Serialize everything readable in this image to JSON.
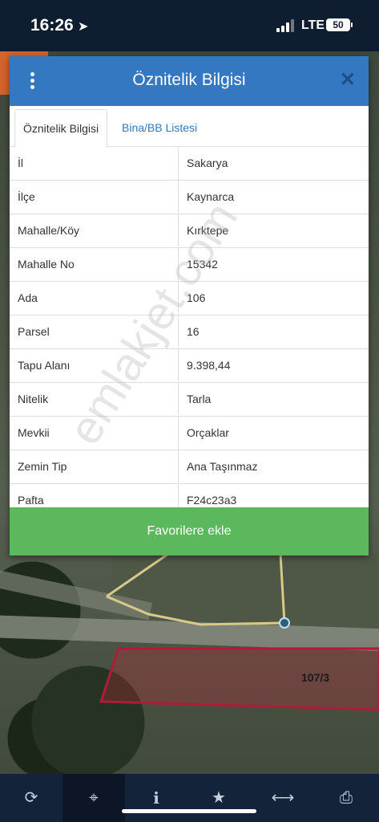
{
  "status_bar": {
    "time": "16:26",
    "network": "LTE",
    "battery": "50"
  },
  "dialog": {
    "title": "Öznitelik Bilgisi",
    "tabs": [
      "Öznitelik Bilgisi",
      "Bina/BB Listesi"
    ],
    "rows": [
      {
        "key": "İl",
        "value": "Sakarya"
      },
      {
        "key": "İlçe",
        "value": "Kaynarca"
      },
      {
        "key": "Mahalle/Köy",
        "value": "Kırktepe"
      },
      {
        "key": "Mahalle No",
        "value": "15342"
      },
      {
        "key": "Ada",
        "value": "106"
      },
      {
        "key": "Parsel",
        "value": "16"
      },
      {
        "key": "Tapu Alanı",
        "value": "9.398,44"
      },
      {
        "key": "Nitelik",
        "value": "Tarla"
      },
      {
        "key": "Mevkii",
        "value": "Orçaklar"
      },
      {
        "key": "Zemin Tip",
        "value": "Ana Taşınmaz"
      },
      {
        "key": "Pafta",
        "value": "F24c23a3"
      }
    ],
    "favorite_button": "Favorilere ekle"
  },
  "watermark": "emlakjet.com",
  "map": {
    "parcel_label": "107/3"
  },
  "toolbar": {
    "icons": [
      "refresh-icon",
      "locate-icon",
      "info-icon",
      "star-icon",
      "measure-icon",
      "print-icon"
    ],
    "active_index": 1
  },
  "colors": {
    "header": "#3478c1",
    "button": "#5cb85c",
    "toolbar": "#13233a"
  }
}
